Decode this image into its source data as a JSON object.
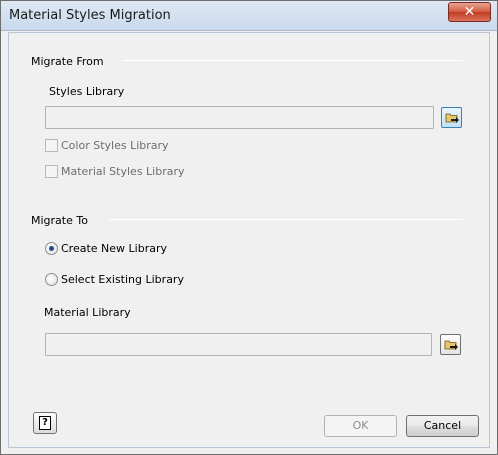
{
  "window": {
    "title": "Material Styles Migration"
  },
  "migrate_from": {
    "section_label": "Migrate From",
    "styles_library_label": "Styles Library",
    "styles_library_value": "",
    "color_styles_checkbox": {
      "label": "Color Styles Library",
      "checked": false,
      "enabled": false
    },
    "material_styles_checkbox": {
      "label": "Material Styles Library",
      "checked": false,
      "enabled": false
    }
  },
  "migrate_to": {
    "section_label": "Migrate To",
    "options": [
      {
        "label": "Create New Library",
        "selected": true
      },
      {
        "label": "Select Existing Library",
        "selected": false
      }
    ],
    "material_library_label": "Material Library",
    "material_library_value": ""
  },
  "buttons": {
    "help_icon": "?",
    "ok_label": "OK",
    "cancel_label": "Cancel"
  },
  "icons": {
    "close": "close-icon",
    "browse": "folder-browse-icon",
    "help": "help-icon"
  },
  "colors": {
    "close_button": "#c23b22",
    "title_bar": "#c9d9ec",
    "dialog_background": "#f0f0f0",
    "radio_selected": "#1c4a8a"
  }
}
